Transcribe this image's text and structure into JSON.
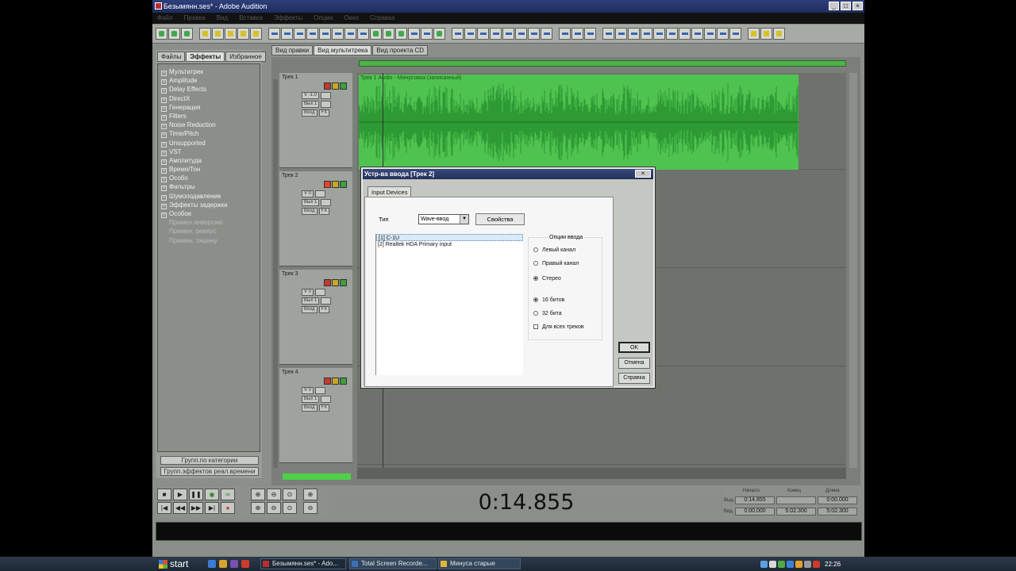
{
  "window": {
    "title": "Безымянн.ses* - Adobe Audition"
  },
  "menu": [
    "Файл",
    "Правка",
    "Вид",
    "Вставка",
    "Эффекты",
    "Опции",
    "Окно",
    "Справка"
  ],
  "left_panel": {
    "tabs": [
      "Файлы",
      "Эффекты",
      "Избранное"
    ],
    "effects": [
      "Мультитрек",
      "Amplitude",
      "Delay Effects",
      "DirectX",
      "Генерация",
      "Filters",
      "Noise Reduction",
      "Time/Pitch",
      "Unsupported",
      "VST",
      "Амплитуда",
      "Время/Тон",
      "Особо",
      "Фильтры",
      "Шумоподавление",
      "Эффекты задержки",
      "Особое"
    ],
    "sub_items": [
      "Примен.инверсию",
      "Примен. реверс",
      "Примен. тишину"
    ],
    "buttons": [
      "Групп.по категории",
      "Групп.эффектов реал.времени"
    ]
  },
  "view_tabs": [
    "Вид правки",
    "Вид мультитрека",
    "Вид проекта CD"
  ],
  "tracks": [
    {
      "name": "Трек 1",
      "volume": "V -1.0",
      "out": "Вых 1",
      "input": "Вход",
      "fx": "FX"
    },
    {
      "name": "Трек 2",
      "volume": "V 0",
      "out": "Вых 1",
      "input": "Вход",
      "fx": "FX"
    },
    {
      "name": "Трек 3",
      "volume": "V 0",
      "out": "Вых 1",
      "input": "Вход",
      "fx": "FX"
    },
    {
      "name": "Трек 4",
      "volume": "V 0",
      "out": "Вых 1",
      "input": "Вход",
      "fx": "FX"
    }
  ],
  "clip_label": "Трек 1 Audio - Минусовка (записанный)",
  "transport": {
    "time": "0:14.855",
    "begin_label": "Начало",
    "end_label": "Конец",
    "length_label": "Длина",
    "sel_label": "Выд.",
    "view_label": "Вид",
    "sel_begin": "0:14.855",
    "sel_end": "",
    "sel_length": "0:00.000",
    "view_begin": "0:00.000",
    "view_end": "5:02.300",
    "view_length": "5:02.300"
  },
  "dialog": {
    "title": "Устр-ва ввода [Трек 2]",
    "tab": "Input Devices",
    "type_label": "Тип",
    "type_value": "Wave-ввод",
    "properties_button": "Свойства",
    "devices": [
      "[1] C-1U",
      "[2] Realtek HDA Primary input"
    ],
    "options_title": "Опции ввода",
    "left_channel": "Левый канал",
    "right_channel": "Правый канал",
    "stereo": "Стерео",
    "bits16": "16 битов",
    "bits32": "32 бита",
    "all_tracks": "Для всех треков",
    "ok": "OK",
    "cancel": "Отмена",
    "help": "Справка"
  },
  "taskbar": {
    "start": "start",
    "tasks": [
      "Безымянн.ses* - Ado...",
      "Total Screen Recorde...",
      "Минуса старые"
    ],
    "clock": "22:26"
  }
}
